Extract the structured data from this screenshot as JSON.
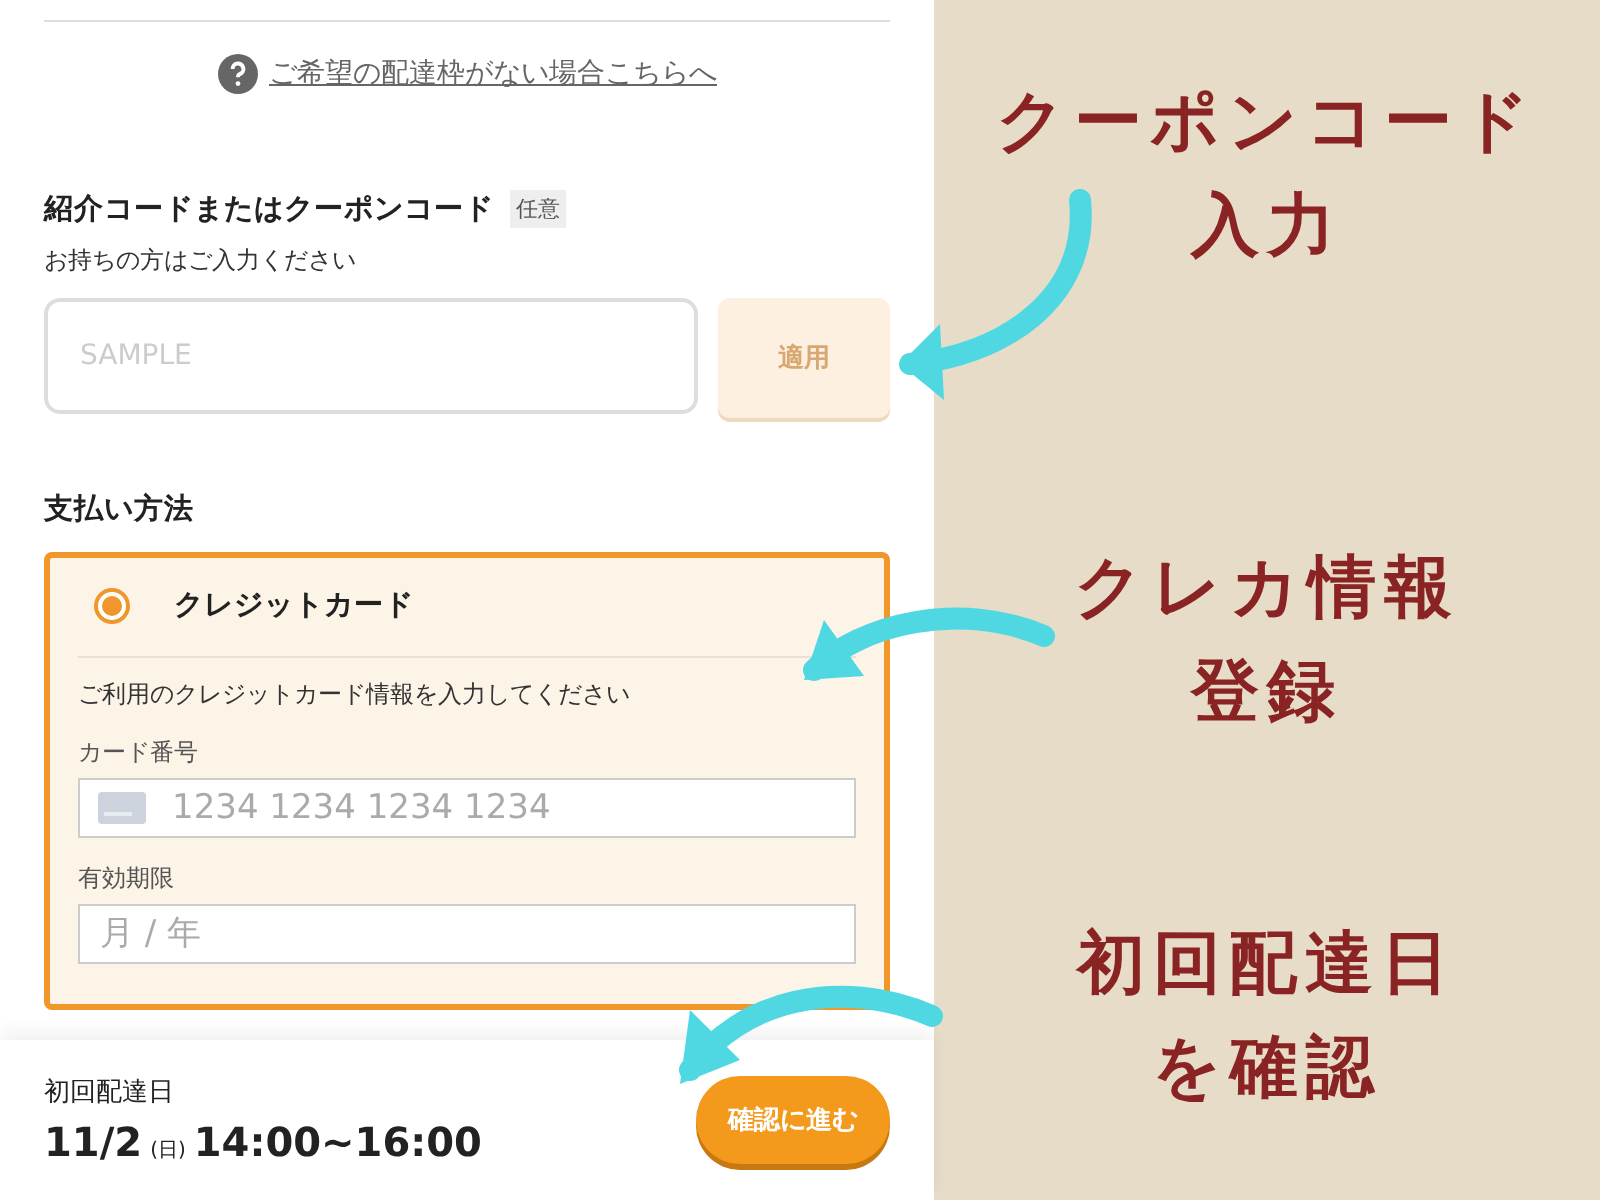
{
  "help_link": "ご希望の配達枠がない場合こちらへ",
  "coupon": {
    "title": "紹介コードまたはクーポンコード",
    "badge": "任意",
    "hint": "お持ちの方はご入力ください",
    "placeholder": "SAMPLE",
    "apply_button": {
      "label": "適用",
      "disabled": true
    }
  },
  "payment": {
    "title": "支払い方法",
    "methods": [
      {
        "label": "クレジットカード",
        "selected": true
      }
    ],
    "instruction": "ご利用のクレジットカード情報を入力してください",
    "fields": [
      {
        "label": "カード番号",
        "placeholder": "1234 1234 1234 1234",
        "kind": "card"
      },
      {
        "label": "有効期限",
        "placeholder": "月 / 年",
        "kind": "plain"
      }
    ]
  },
  "footer": {
    "label": "初回配達日",
    "date": "11/2",
    "weekday": "(日)",
    "time": "14:00~16:00",
    "confirm_button": "確認に進む"
  },
  "annotations": [
    {
      "lines": [
        "クーポンコード",
        "入力"
      ]
    },
    {
      "lines": [
        "クレカ情報",
        "登録"
      ]
    },
    {
      "lines": [
        "初回配達日",
        "を確認"
      ]
    }
  ]
}
